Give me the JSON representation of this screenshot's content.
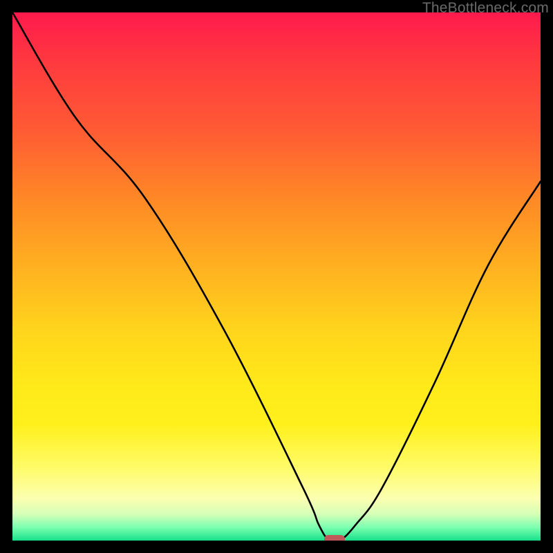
{
  "watermark": "TheBottleneck.com",
  "chart_data": {
    "type": "line",
    "title": "",
    "xlabel": "",
    "ylabel": "",
    "xlim": [
      0,
      100
    ],
    "ylim": [
      0,
      100
    ],
    "grid": false,
    "series": [
      {
        "name": "bottleneck-curve",
        "x": [
          0,
          12,
          25,
          40,
          55,
          58,
          60,
          62,
          65,
          70,
          80,
          90,
          100
        ],
        "values": [
          100,
          80,
          65,
          40,
          10,
          3,
          0,
          0,
          3,
          10,
          30,
          52,
          68
        ]
      }
    ],
    "marker": {
      "x": 61,
      "y": 0,
      "width_pct": 4,
      "height_pct": 1.6
    },
    "background_gradient_meaning": "vertical red-to-green bottleneck severity"
  },
  "colors": {
    "curve": "#000000",
    "marker": "#c05a5a",
    "frame": "#000000"
  }
}
